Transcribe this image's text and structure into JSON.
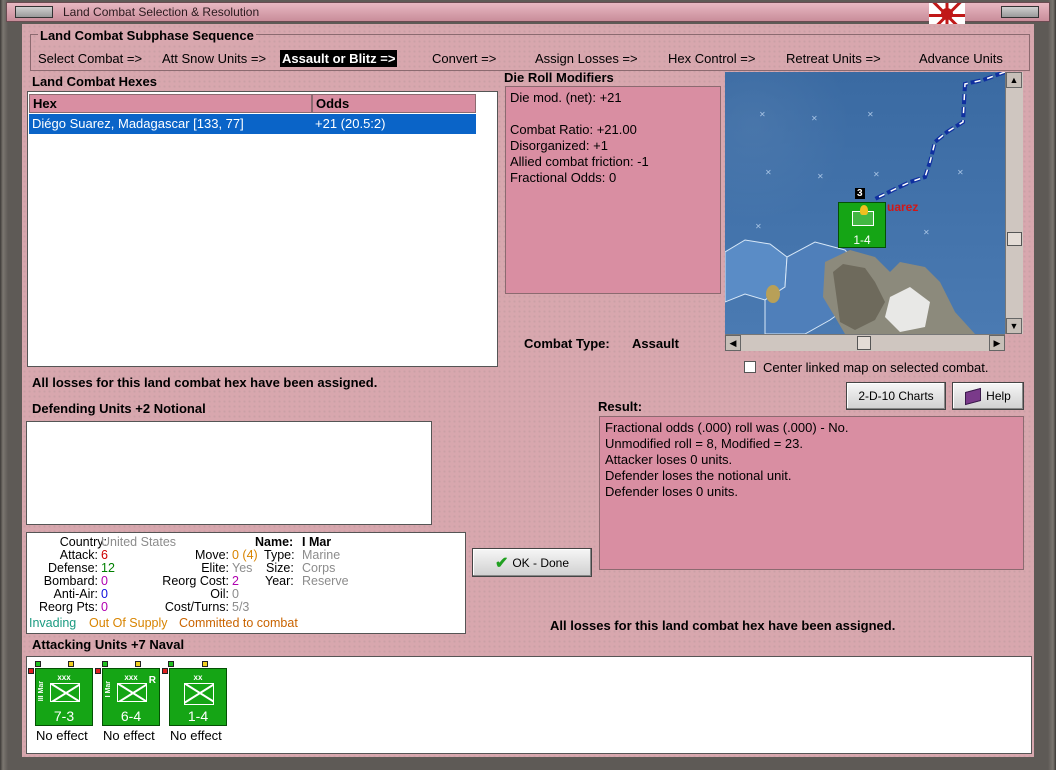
{
  "window": {
    "title": "Land Combat Selection & Resolution"
  },
  "subphase": {
    "header": "Land Combat Subphase Sequence",
    "steps": [
      {
        "label": "Select Combat =>",
        "active": false
      },
      {
        "label": "Att Snow Units =>",
        "active": false
      },
      {
        "label": "Assault or Blitz =>",
        "active": true
      },
      {
        "label": "Convert =>",
        "active": false
      },
      {
        "label": "Assign Losses =>",
        "active": false
      },
      {
        "label": "Hex Control =>",
        "active": false
      },
      {
        "label": "Retreat Units =>",
        "active": false
      },
      {
        "label": "Advance Units",
        "active": false
      }
    ]
  },
  "hexes": {
    "header": "Land Combat Hexes",
    "col_hex": "Hex",
    "col_odds": "Odds",
    "rows": [
      {
        "hex": "Diégo Suarez, Madagascar [133, 77]",
        "odds": "+21 (20.5:2)"
      }
    ]
  },
  "modifiers": {
    "header": "Die Roll Modifiers",
    "lines": [
      "Die mod. (net): +21",
      "",
      "Combat Ratio: +21.00",
      "Disorganized: +1",
      "Allied combat friction: -1",
      "Fractional Odds: 0"
    ]
  },
  "combat_type": {
    "label": "Combat Type:",
    "value": "Assault"
  },
  "map": {
    "city_label": "uarez",
    "stack_count": "3",
    "unit_strength": "1-4"
  },
  "center_map": {
    "label": "Center linked map on selected combat.",
    "checked": false
  },
  "losses_msg_top": "All losses for this land combat hex have been assigned.",
  "losses_msg_bottom": "All losses for this land combat hex have been assigned.",
  "buttons": {
    "charts": "2-D-10 Charts",
    "help": "Help",
    "ok": "OK - Done"
  },
  "defending": {
    "header": "Defending Units +2 Notional"
  },
  "result": {
    "header": "Result:",
    "lines": [
      "Fractional odds (.000) roll was (.000)  - No.",
      "Unmodified roll = 8, Modified = 23.",
      "Attacker loses 0 units.",
      "Defender loses the notional unit.",
      "Defender loses 0 units."
    ]
  },
  "unit_info": {
    "country_label": "Country:",
    "country": "United States",
    "attack_label": "Attack:",
    "attack": "6",
    "defense_label": "Defense:",
    "defense": "12",
    "bombard_label": "Bombard:",
    "bombard": "0",
    "antiair_label": "Anti-Air:",
    "antiair": "0",
    "reorgpts_label": "Reorg Pts:",
    "reorgpts": "0",
    "move_label": "Move:",
    "move": "0 (4)",
    "elite_label": "Elite:",
    "elite": "Yes",
    "reorgcost_label": "Reorg Cost:",
    "reorgcost": "2",
    "oil_label": "Oil:",
    "oil": "0",
    "costturns_label": "Cost/Turns:",
    "costturns": "5/3",
    "name_label": "Name:",
    "name": "I Mar",
    "type_label": "Type:",
    "type": "Marine",
    "size_label": "Size:",
    "size": "Corps",
    "year_label": "Year:",
    "year": "Reserve",
    "status_invading": "Invading",
    "status_supply": "Out Of Supply",
    "status_committed": "Committed to combat"
  },
  "attacking": {
    "header": "Attacking Units +7 Naval",
    "units": [
      {
        "name": "III Mar",
        "size": "xxx",
        "strength": "7-3",
        "reserve": "",
        "effect": "No effect"
      },
      {
        "name": "I Mar",
        "size": "xxx",
        "strength": "6-4",
        "reserve": "R",
        "effect": "No effect"
      },
      {
        "name": "",
        "size": "xx",
        "strength": "1-4",
        "reserve": "",
        "effect": "No effect"
      }
    ]
  },
  "colors": {
    "panel_pink": "#d98ea2",
    "selection_blue": "#0a64c8",
    "counter_green": "#15a515"
  }
}
